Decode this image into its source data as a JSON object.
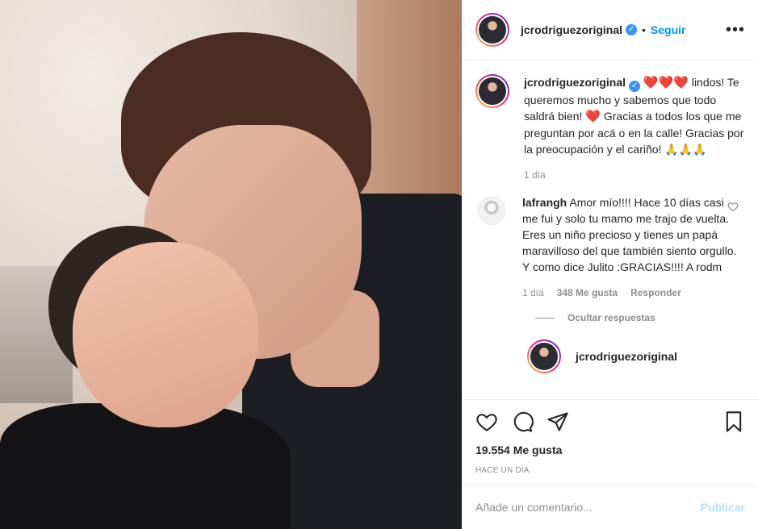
{
  "header": {
    "username": "jcrodriguezoriginal",
    "separator": "•",
    "follow_label": "Seguir",
    "more_label": "•••"
  },
  "caption": {
    "username": "jcrodriguezoriginal",
    "hearts_top": "❤️❤️❤️",
    "text_1": "lindos! Te queremos mucho y sabemos que todo saldrá bien!",
    "heart_mid": "❤️",
    "text_2": "Gracias a todos los que me preguntan por acá o en la calle! Gracias por la preocupación y el cariño!",
    "emoji_end": "🙏🙏🙏",
    "time": "1 día"
  },
  "comment_1": {
    "username": "lafrangh",
    "text": "Amor mío!!!! Hace 10 días casi me fui y solo tu mamo me trajo de vuelta. Eres un niño precioso y tienes un papá maravilloso del que también siento orgullo. Y como dice Julito :GRACIAS!!!! A rodm",
    "time": "1 día",
    "likes": "348 Me gusta",
    "reply_label": "Responder",
    "hide_replies": "Ocultar respuestas"
  },
  "reply_1": {
    "username": "jcrodriguezoriginal"
  },
  "actions": {
    "likes_count": "19.554 Me gusta",
    "date": "HACE UN DÍA"
  },
  "add_comment": {
    "placeholder": "Añade un comentario...",
    "publish_label": "Publicar"
  },
  "colors": {
    "accent": "#0095f6",
    "publish_disabled": "#b2dffc",
    "verified": "#3897f0",
    "muted": "#8e8e8e"
  }
}
